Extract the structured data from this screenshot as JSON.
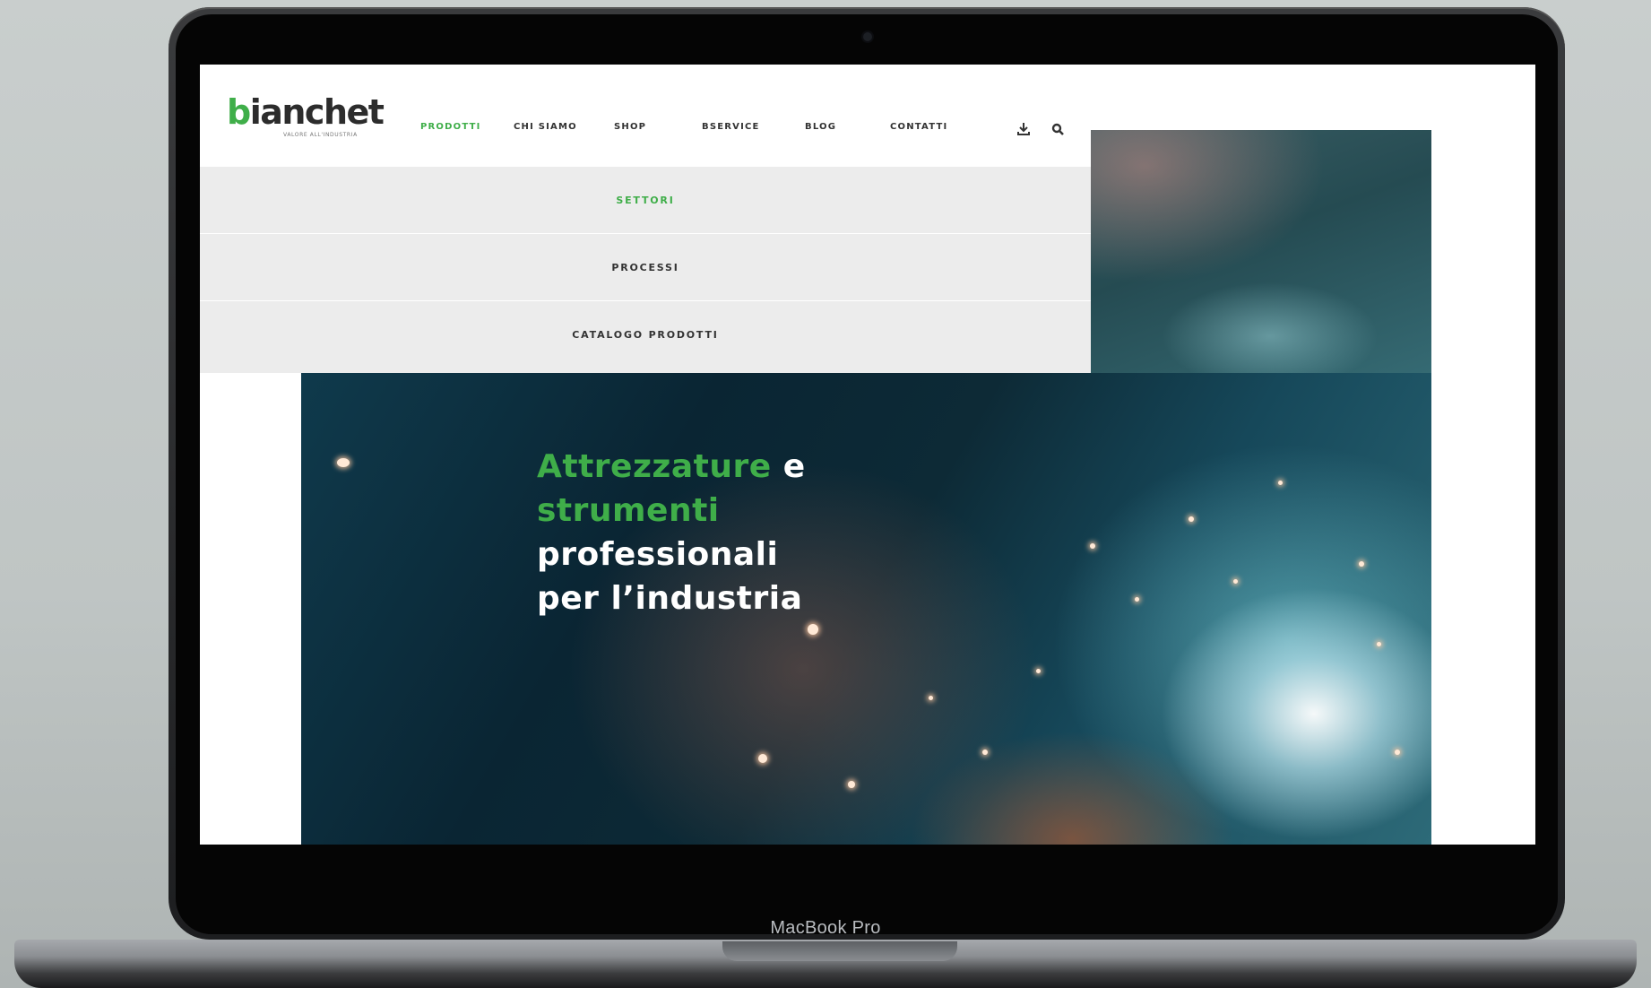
{
  "device": {
    "label": "MacBook Pro"
  },
  "brand": {
    "name_accent": "b",
    "name_rest": "ianchet",
    "tagline": "VALORE ALL'INDUSTRIA",
    "accent_color": "#3fae49"
  },
  "nav": {
    "items": [
      "PRODOTTI",
      "CHI SIAMO",
      "SHOP",
      "BSERVICE",
      "BLOG",
      "CONTATTI"
    ],
    "active": "PRODOTTI",
    "icons": [
      "download-icon",
      "search-icon"
    ]
  },
  "dropdown": {
    "items": [
      "SETTORI",
      "PROCESSI",
      "CATALOGO PRODOTTI"
    ],
    "active": "SETTORI"
  },
  "hero": {
    "line1_green": "Attrezzature",
    "line1_white": " e",
    "line2_green": "strumenti",
    "line3": "professionali",
    "line4": "per l’industria"
  }
}
